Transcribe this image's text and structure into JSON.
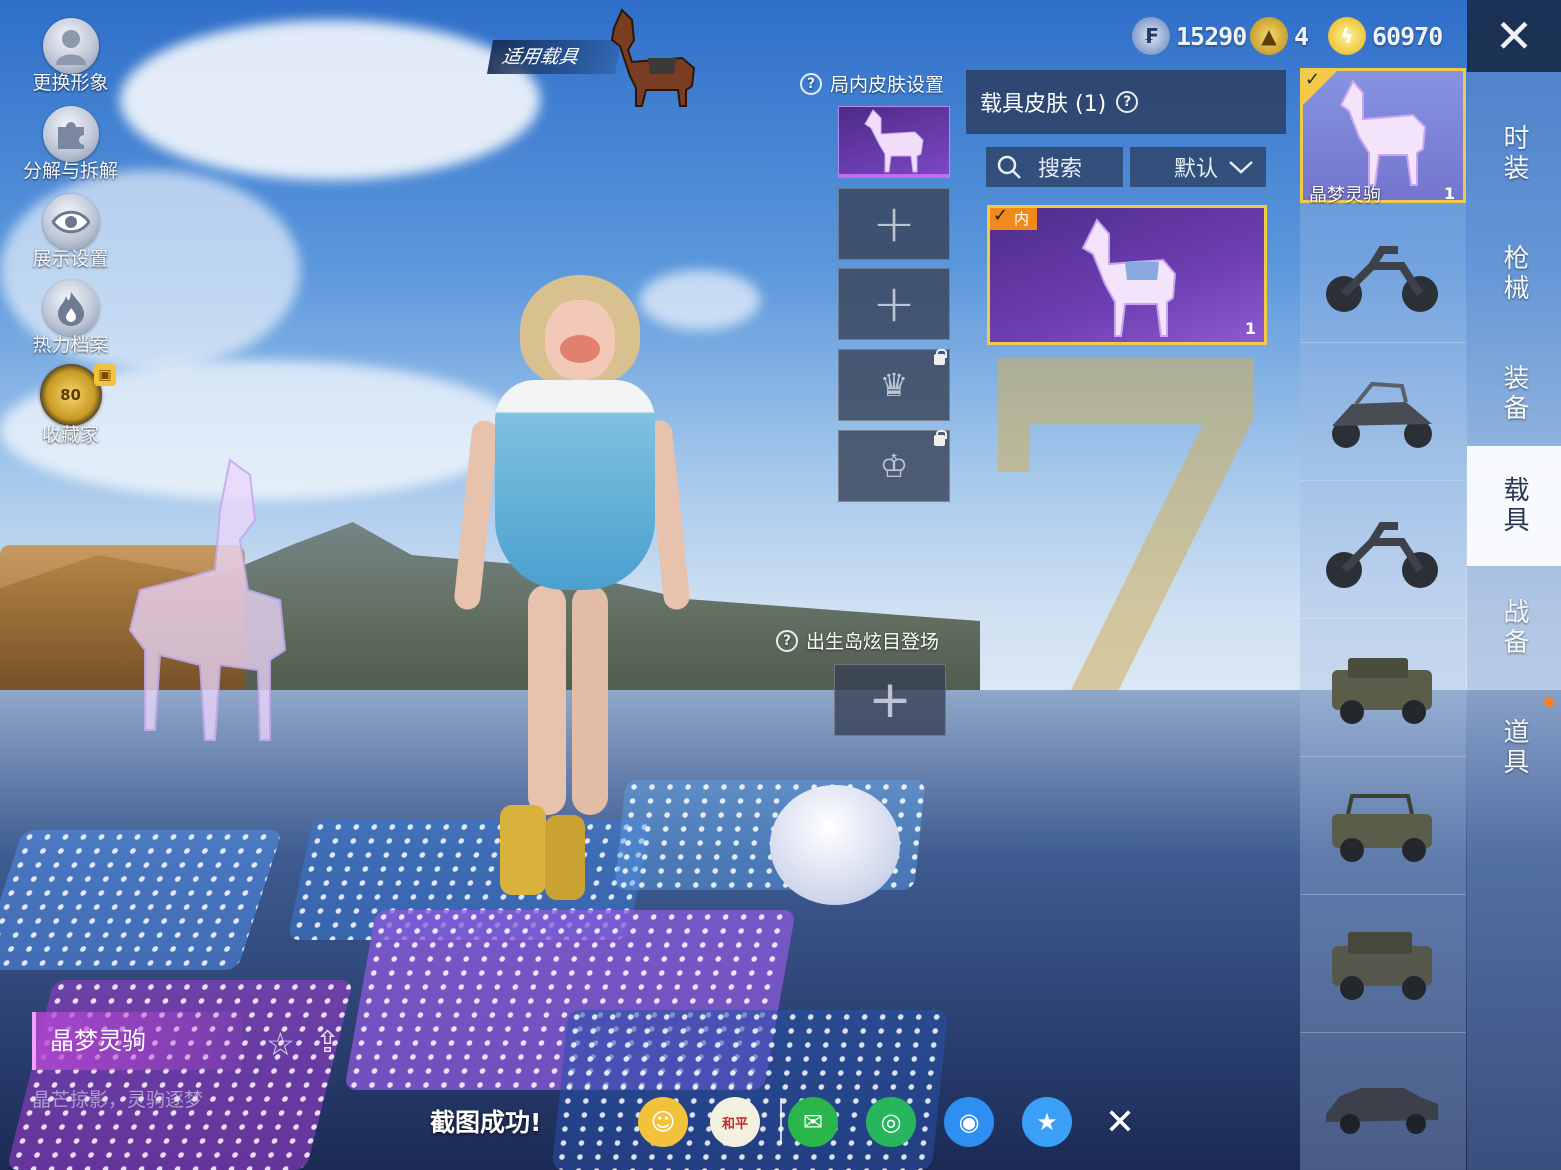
{
  "currencies": [
    {
      "name": "silver-coin",
      "value": "15290",
      "color": "#5e7fb8"
    },
    {
      "name": "gold-token",
      "value": "4",
      "color": "#d8a727"
    },
    {
      "name": "energy-coin",
      "value": "60970",
      "color": "#f2c11c"
    }
  ],
  "left_menu": {
    "change_avatar": "更换形象",
    "decompose": "分解与拆解",
    "display_settings": "展示设置",
    "heat_archive": "热力档案",
    "collector": "收藏家",
    "collector_level": "80"
  },
  "applicable_vehicle": "适用载具",
  "in_game_skin_settings": "局内皮肤设置",
  "spawn_island_entrance": "出生岛炫目登场",
  "skin_panel": {
    "title": "载具皮肤 (1)",
    "search_label": "搜索",
    "sort_label": "默认",
    "card": {
      "badge": "内",
      "count": "1"
    }
  },
  "vehicle_list": {
    "selected_name": "晶梦灵驹",
    "selected_count": "1"
  },
  "side_nav": [
    "时装",
    "枪械",
    "装备",
    "载具",
    "战备",
    "道具"
  ],
  "side_nav_active": "载具",
  "item": {
    "name": "晶梦灵驹",
    "description": "晶芒掠影，灵驹逐梦"
  },
  "screenshot_status": "截图成功!",
  "share_targets": [
    "profile-share",
    "game-for-peace",
    "wechat",
    "moments",
    "qq",
    "qzone",
    "close"
  ],
  "colors": {
    "accent_gold": "#f3c948",
    "panel_dark": "#28324b",
    "skin_purple": "#6d3fb2",
    "nav_active_bg": "#ffffff",
    "notification_dot": "#ff7d27"
  }
}
